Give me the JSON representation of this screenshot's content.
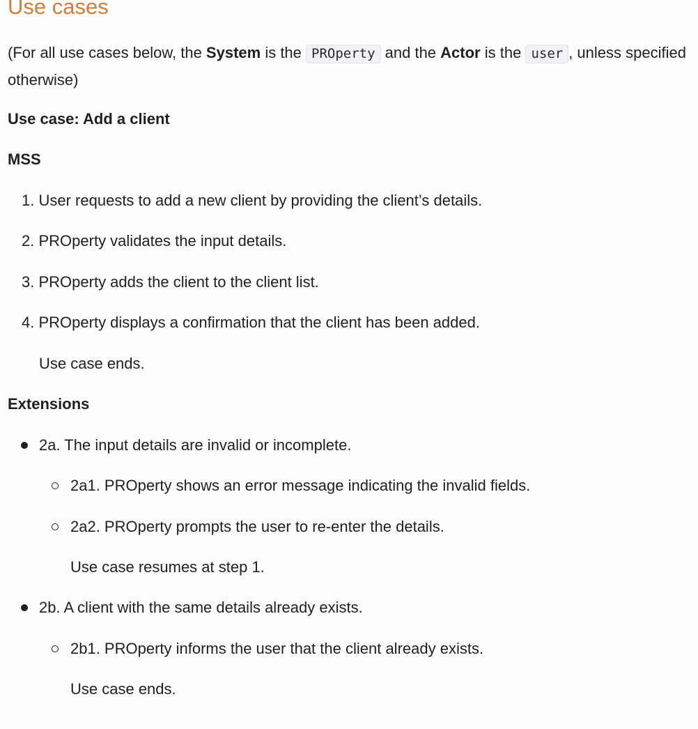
{
  "heading": "Use cases",
  "intro": {
    "prefix": "(For all use cases below, the ",
    "system_label": "System",
    "mid1": " is the ",
    "system_code": "PROperty",
    "mid2": " and the ",
    "actor_label": "Actor",
    "mid3": " is the ",
    "actor_code": "user",
    "suffix": ", unless specified otherwise)"
  },
  "use_case_title": "Use case: Add a client",
  "mss_title": "MSS",
  "mss_steps": [
    {
      "num": "1.",
      "text": "User requests to add a new client by providing the client’s details."
    },
    {
      "num": "2.",
      "text": "PROperty validates the input details."
    },
    {
      "num": "3.",
      "text": "PROperty adds the client to the client list."
    },
    {
      "num": "4.",
      "text": "PROperty displays a confirmation that the client has been added."
    }
  ],
  "mss_end": "Use case ends.",
  "extensions_title": "Extensions",
  "extensions": [
    {
      "text": "2a. The input details are invalid or incomplete.",
      "sub": [
        "2a1. PROperty shows an error message indicating the invalid fields.",
        "2a2. PROperty prompts the user to re-enter the details."
      ],
      "end": "Use case resumes at step 1."
    },
    {
      "text": "2b. A client with the same details already exists.",
      "sub": [
        "2b1. PROperty informs the user that the client already exists."
      ],
      "end": "Use case ends."
    }
  ]
}
